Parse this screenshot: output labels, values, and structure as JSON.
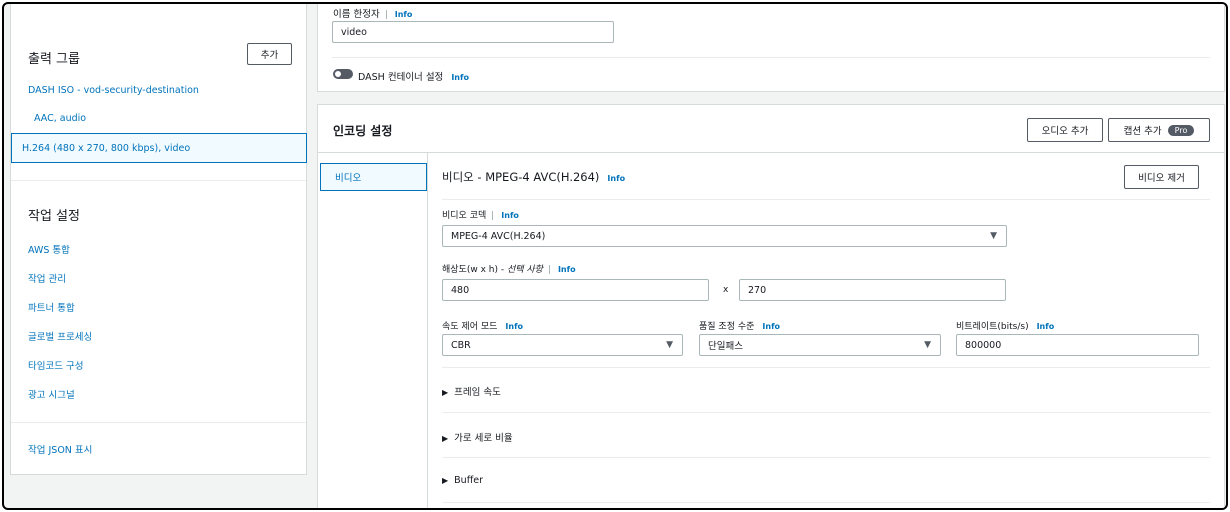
{
  "sidebar": {
    "output_groups_title": "출력 그룹",
    "add_label": "추가",
    "output_group_name": "DASH ISO - vod-security-destination",
    "outputs": [
      {
        "label": "AAC, audio"
      },
      {
        "label": "H.264 (480 x 270, 800 kbps), video"
      }
    ],
    "job_settings_title": "작업 설정",
    "job_settings_items": [
      {
        "label": "AWS 통합"
      },
      {
        "label": "작업 관리"
      },
      {
        "label": "파트너 통합"
      },
      {
        "label": "글로벌 프로세싱"
      },
      {
        "label": "타임코드 구성"
      },
      {
        "label": "광고 시그널"
      }
    ],
    "show_json_label": "작업 JSON 표시"
  },
  "top_panel": {
    "name_modifier_label": "이름 한정자",
    "name_modifier_value": "video",
    "dash_container_label": "DASH 컨테이너 설정",
    "info": "Info"
  },
  "encoding": {
    "title": "인코딩 설정",
    "add_audio_label": "오디오 추가",
    "add_caption_label": "캡션 추가",
    "pro_badge": "Pro",
    "tab_video": "비디오",
    "section_title": "비디오 - MPEG-4 AVC(H.264)",
    "remove_video_label": "비디오 제거",
    "codec_label": "비디오 코덱",
    "codec_value": "MPEG-4 AVC(H.264)",
    "resolution_label": "해상도(w x h) - ",
    "resolution_optional": "선택 사항",
    "width": "480",
    "x_sep": "x",
    "height": "270",
    "rate_control_label": "속도 제어 모드",
    "rate_control_value": "CBR",
    "quality_label": "품질 조정 수준",
    "quality_value": "단일패스",
    "bitrate_label": "비트레이트(bits/s)",
    "bitrate_value": "800000",
    "framerate_label": "프레임 속도",
    "aspect_label": "가로 세로 비율",
    "buffer_label": "Buffer"
  },
  "colors": {
    "link": "#0073bb",
    "selected_bg": "#f1faff",
    "border": "#d5dbdb"
  }
}
